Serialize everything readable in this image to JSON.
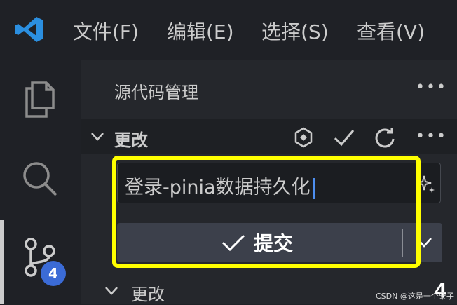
{
  "menu": {
    "file": "文件(F)",
    "edit": "编辑(E)",
    "selection": "选择(S)",
    "view": "查看(V)"
  },
  "activity_bar": {
    "scm_badge": "4"
  },
  "sidebar": {
    "title": "源代码管理",
    "changes_section": "更改",
    "commit_message": "登录-pinia数据持久化",
    "commit_button_label": "提交",
    "changes_group": "更改",
    "changes_count": "4"
  },
  "watermark": "CSDN @这是一个栗子",
  "colors": {
    "highlight": "#ffff00",
    "badge": "#3b6bd6",
    "caret": "#4d8ef0"
  }
}
